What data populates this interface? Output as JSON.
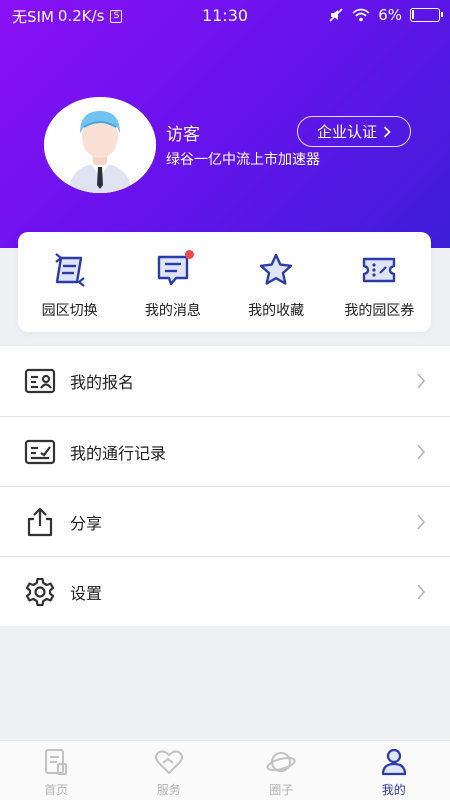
{
  "status_bar": {
    "carrier": "无SIM",
    "speed": "0.2K/s",
    "speed_badge": "S",
    "time": "11:30",
    "battery": "6%",
    "battery_level": 0.06
  },
  "profile": {
    "username": "访客",
    "park_name": "绿谷一亿中流上市加速器",
    "verify_label": "企业认证"
  },
  "quick_actions": [
    {
      "label": "园区切换",
      "icon": "switch-icon"
    },
    {
      "label": "我的消息",
      "icon": "message-icon",
      "badge": true
    },
    {
      "label": "我的收藏",
      "icon": "star-icon"
    },
    {
      "label": "我的园区券",
      "icon": "ticket-icon"
    }
  ],
  "menu": [
    {
      "label": "我的报名",
      "icon": "id-card-icon"
    },
    {
      "label": "我的通行记录",
      "icon": "record-icon"
    },
    {
      "label": "分享",
      "icon": "share-icon"
    },
    {
      "label": "设置",
      "icon": "gear-icon"
    }
  ],
  "tabs": [
    {
      "label": "首页",
      "icon": "home-doc-icon",
      "active": false
    },
    {
      "label": "服务",
      "icon": "heart-hands-icon",
      "active": false
    },
    {
      "label": "圈子",
      "icon": "planet-icon",
      "active": false
    },
    {
      "label": "我的",
      "icon": "user-icon",
      "active": true
    }
  ],
  "colors": {
    "header_start": "#8a11f5",
    "header_end": "#3d1fd8",
    "icon_blue": "#2b3ca8",
    "badge_red": "#f24a4a"
  }
}
